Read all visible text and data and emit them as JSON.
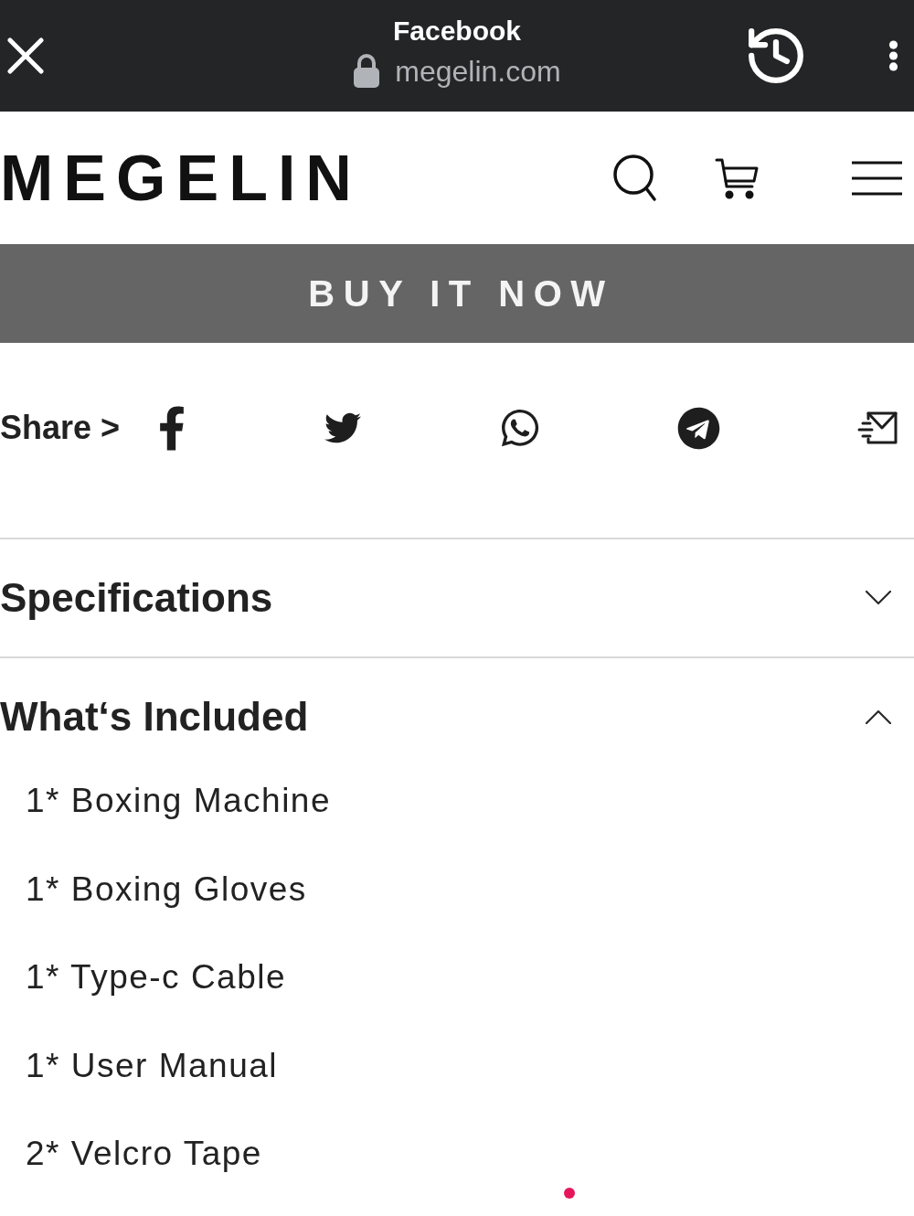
{
  "browser_bar": {
    "title": "Facebook",
    "url": "megelin.com"
  },
  "header": {
    "logo": "MEGELIN"
  },
  "buy_button": {
    "label": "BUY IT NOW"
  },
  "share": {
    "label": "Share >"
  },
  "sections": [
    {
      "title": "Specifications",
      "expanded": false
    },
    {
      "title": "What‘s Included",
      "expanded": true,
      "items": [
        "1* Boxing Machine",
        "1* Boxing Gloves",
        "1* Type-c Cable",
        "1* User Manual",
        "2* Velcro Tape"
      ]
    }
  ]
}
